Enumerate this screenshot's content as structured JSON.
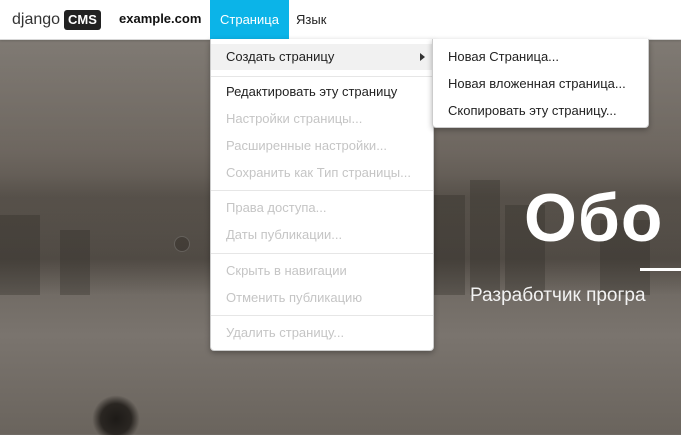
{
  "logo": {
    "django": "django",
    "cms": "CMS"
  },
  "toolbar": {
    "site_name": "example.com",
    "menu_page": "Страница",
    "menu_language": "Язык"
  },
  "page_menu": {
    "create_page": "Создать страницу",
    "edit_page": "Редактировать эту страницу",
    "page_settings": "Настройки страницы...",
    "advanced_settings": "Расширенные настройки...",
    "save_as_type": "Сохранить как Тип страницы...",
    "permissions": "Права доступа...",
    "publish_dates": "Даты публикации...",
    "hide_in_nav": "Скрыть в навигации",
    "unpublish": "Отменить публикацию",
    "delete_page": "Удалить страницу..."
  },
  "create_submenu": {
    "new_page": "Новая Страница...",
    "new_subpage": "Новая вложенная страница...",
    "copy_page": "Скопировать эту страницу..."
  },
  "hero": {
    "title": "Обо",
    "subtitle": "Разработчик програ"
  }
}
